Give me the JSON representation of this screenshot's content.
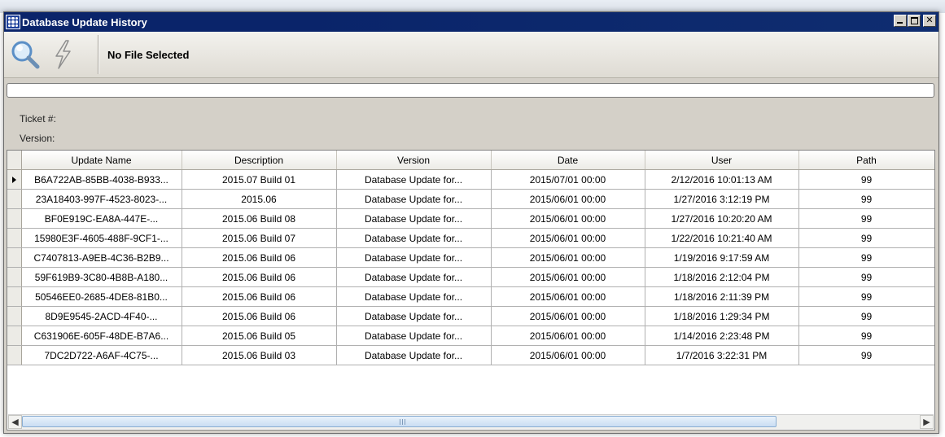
{
  "window": {
    "title": "Database Update History"
  },
  "toolbar": {
    "file_label": "No File Selected",
    "icons": [
      "magnifier-icon",
      "lightning-icon"
    ]
  },
  "path_field": {
    "value": ""
  },
  "meta": {
    "ticket_label": "Ticket #:",
    "version_label": "Version:"
  },
  "grid": {
    "columns": [
      "Update Name",
      "Description",
      "Version",
      "Date",
      "User",
      "Path"
    ],
    "selected_row": 0,
    "rows": [
      [
        "B6A722AB-85BB-4038-B933...",
        "2015.07 Build 01",
        "Database Update for...",
        "2015/07/01 00:00",
        "2/12/2016 10:01:13 AM",
        "99"
      ],
      [
        "23A18403-997F-4523-8023-...",
        "2015.06",
        "Database Update for...",
        "2015/06/01 00:00",
        "1/27/2016 3:12:19 PM",
        "99"
      ],
      [
        "BF0E919C-EA8A-447E-...",
        "2015.06 Build 08",
        "Database Update for...",
        "2015/06/01 00:00",
        "1/27/2016 10:20:20 AM",
        "99"
      ],
      [
        "15980E3F-4605-488F-9CF1-...",
        "2015.06 Build 07",
        "Database Update for...",
        "2015/06/01 00:00",
        "1/22/2016 10:21:40 AM",
        "99"
      ],
      [
        "C7407813-A9EB-4C36-B2B9...",
        "2015.06 Build 06",
        "Database Update for...",
        "2015/06/01 00:00",
        "1/19/2016 9:17:59 AM",
        "99"
      ],
      [
        "59F619B9-3C80-4B8B-A180...",
        "2015.06 Build 06",
        "Database Update for...",
        "2015/06/01 00:00",
        "1/18/2016 2:12:04 PM",
        "99"
      ],
      [
        "50546EE0-2685-4DE8-81B0...",
        "2015.06 Build 06",
        "Database Update for...",
        "2015/06/01 00:00",
        "1/18/2016 2:11:39 PM",
        "99"
      ],
      [
        "8D9E9545-2ACD-4F40-...",
        "2015.06 Build 06",
        "Database Update for...",
        "2015/06/01 00:00",
        "1/18/2016 1:29:34 PM",
        "99"
      ],
      [
        "C631906E-605F-48DE-B7A6...",
        "2015.06 Build 05",
        "Database Update for...",
        "2015/06/01 00:00",
        "1/14/2016 2:23:48 PM",
        "99"
      ],
      [
        "7DC2D722-A6AF-4C75-...",
        "2015.06 Build 03",
        "Database Update for...",
        "2015/06/01 00:00",
        "1/7/2016 3:22:31 PM",
        "99"
      ]
    ]
  },
  "scrollbar": {
    "thumb_fraction": 0.84,
    "position_fraction": 0.0
  }
}
